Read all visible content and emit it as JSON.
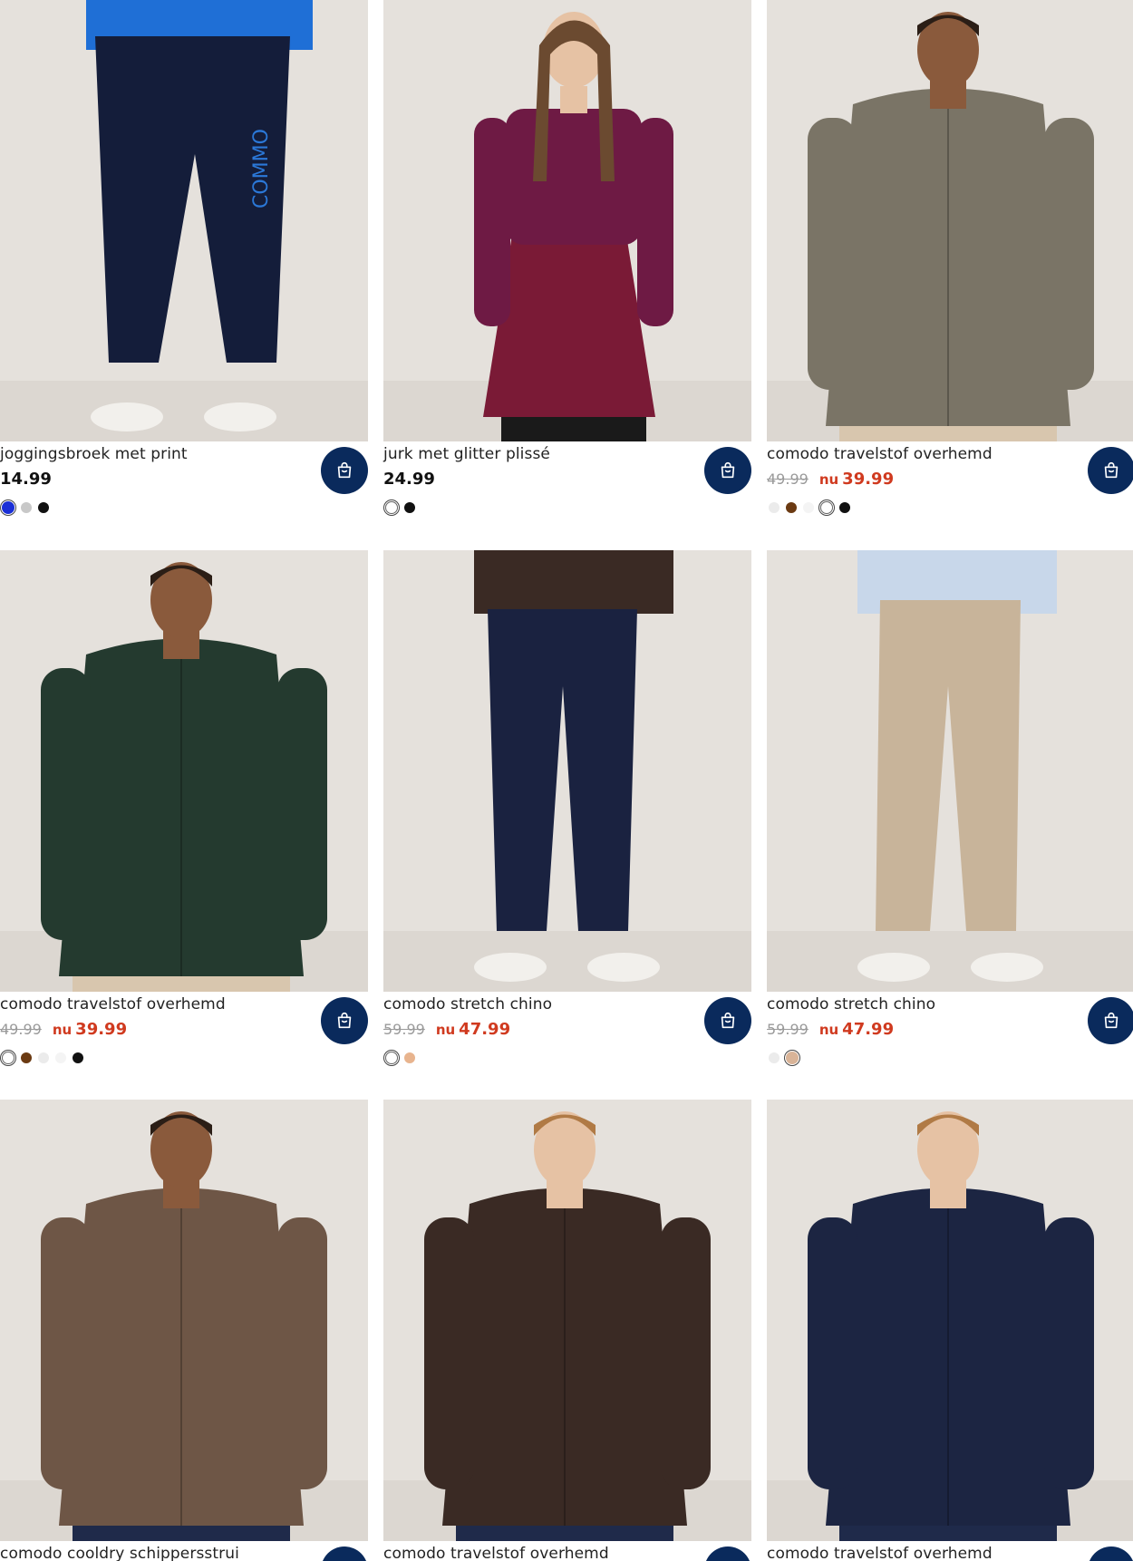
{
  "products": [
    {
      "title": "joggingsbroek met print",
      "price": "14.99",
      "swatches": [
        "#1a2fd6",
        "#c8c8c8",
        "#111111"
      ],
      "selected": 0,
      "scene": "joggers"
    },
    {
      "title": "jurk met glitter plissé",
      "price": "24.99",
      "swatches": [
        "#ffffff",
        "#111111"
      ],
      "selected": 0,
      "scene": "dress"
    },
    {
      "title": "comodo travelstof overhemd",
      "old_price": "49.99",
      "nu_label": "nu",
      "sale_price": "39.99",
      "swatches": [
        "#ebebeb",
        "#6b3a12",
        "#f4f4f4",
        "#ffffff",
        "#111111"
      ],
      "selected": 3,
      "scene": "shirt-taupe"
    },
    {
      "title": "comodo travelstof overhemd",
      "old_price": "49.99",
      "nu_label": "nu",
      "sale_price": "39.99",
      "swatches": [
        "#ffffff",
        "#6b3a12",
        "#ebebeb",
        "#f4f4f4",
        "#111111"
      ],
      "selected": 0,
      "scene": "shirt-green"
    },
    {
      "title": "comodo stretch chino",
      "old_price": "59.99",
      "nu_label": "nu",
      "sale_price": "47.99",
      "swatches": [
        "#ffffff",
        "#e8b48e"
      ],
      "selected": 0,
      "scene": "chino-navy"
    },
    {
      "title": "comodo stretch chino",
      "old_price": "59.99",
      "nu_label": "nu",
      "sale_price": "47.99",
      "swatches": [
        "#ebebeb",
        "#d9b498"
      ],
      "selected": 1,
      "scene": "chino-beige"
    },
    {
      "title": "comodo cooldry schippersstrui",
      "scene": "sweater-brown"
    },
    {
      "title": "comodo travelstof overhemd",
      "scene": "shirt-brown"
    },
    {
      "title": "comodo travelstof overhemd",
      "scene": "shirt-navy"
    }
  ],
  "icons": {
    "cart": "shopping-bag-icon"
  },
  "colors": {
    "accent": "#0a2a5c",
    "sale": "#d03a1f",
    "photo_bg": "#e5e1dc"
  }
}
